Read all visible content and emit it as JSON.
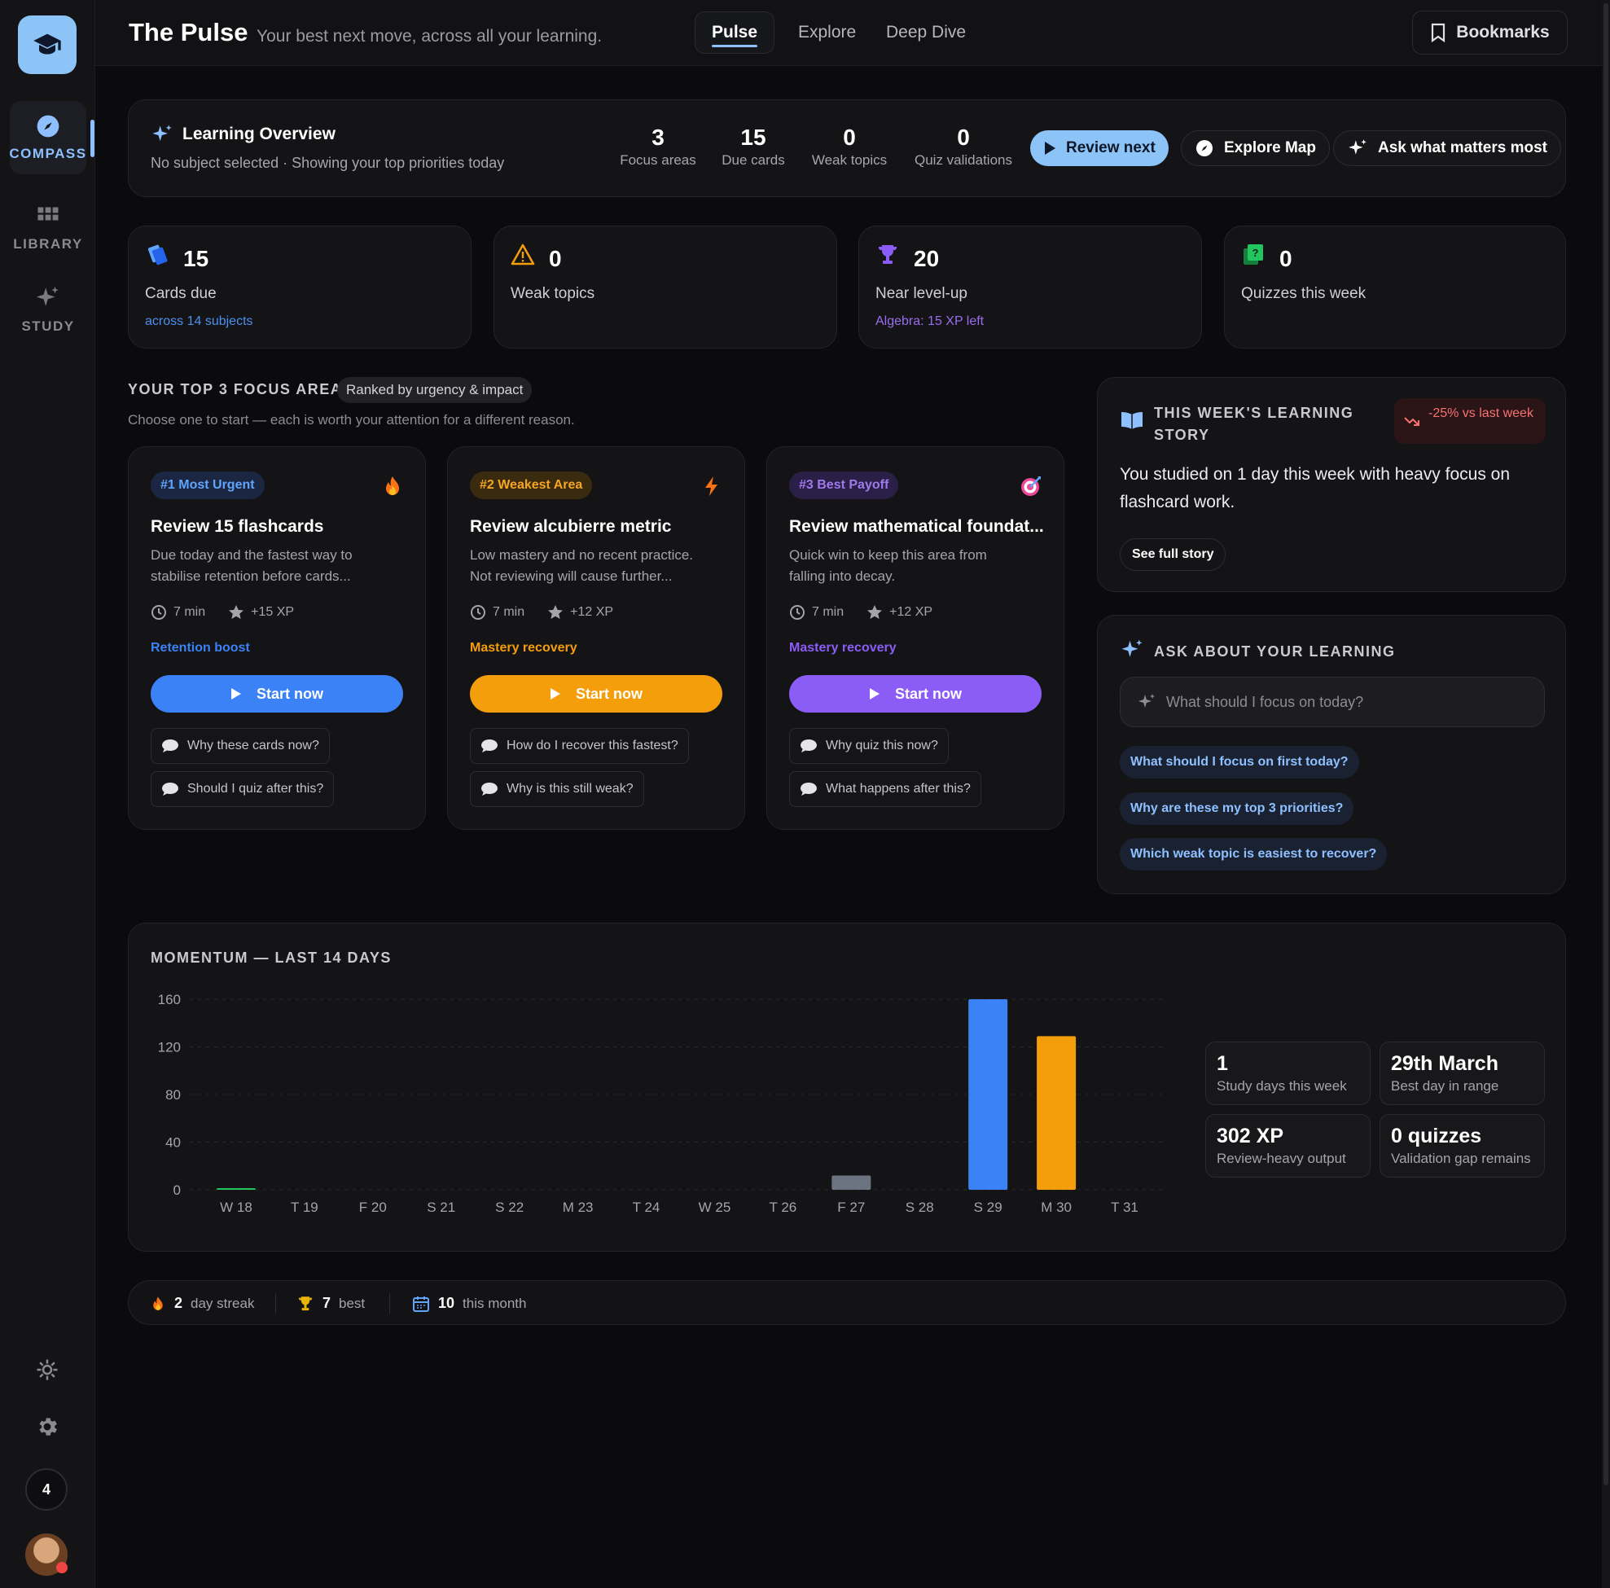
{
  "sidebar": {
    "nav": [
      {
        "label": "COMPASS",
        "icon": "compass-icon"
      },
      {
        "label": "LIBRARY",
        "icon": "grid-icon"
      },
      {
        "label": "STUDY",
        "icon": "sparkle-icon"
      }
    ],
    "notification_count": "4"
  },
  "header": {
    "title": "The Pulse",
    "subtitle": "Your best next move, across all your learning.",
    "tabs": [
      "Pulse",
      "Explore",
      "Deep Dive"
    ],
    "active_tab": "Pulse",
    "bookmarks_label": "Bookmarks"
  },
  "overview": {
    "title": "Learning Overview",
    "subtitle": "No subject selected · Showing your top priorities today",
    "stats": [
      {
        "value": "3",
        "label": "Focus areas"
      },
      {
        "value": "15",
        "label": "Due cards"
      },
      {
        "value": "0",
        "label": "Weak topics"
      },
      {
        "value": "0",
        "label": "Quiz validations"
      }
    ],
    "buttons": {
      "review_next": "Review next",
      "explore_map": "Explore Map",
      "ask": "Ask what matters most"
    }
  },
  "stat_cards": [
    {
      "value": "15",
      "label": "Cards due",
      "sub": "across 14 subjects",
      "sub_color": "#4d8ff0"
    },
    {
      "value": "0",
      "label": "Weak topics",
      "sub": ""
    },
    {
      "value": "20",
      "label": "Near level-up",
      "sub": "Algebra: 15 XP left",
      "sub_color": "#9a6cf0"
    },
    {
      "value": "0",
      "label": "Quizzes this week",
      "sub": ""
    }
  ],
  "focus": {
    "heading": "YOUR TOP 3 FOCUS AREAS",
    "ranked_badge": "Ranked by urgency & impact",
    "subheading": "Choose one to start — each is worth your attention for a different reason.",
    "cards": [
      {
        "badge": "#1 Most Urgent",
        "title": "Review 15 flashcards",
        "desc": "Due today and the fastest way to stabilise retention before cards...",
        "time": "7 min",
        "xp": "+15 XP",
        "tag": "Retention boost",
        "start": "Start now",
        "chips": [
          "Why these cards now?",
          "Should I quiz after this?"
        ],
        "accent": "#3b82f6",
        "emoji": "fire-icon"
      },
      {
        "badge": "#2 Weakest Area",
        "title": "Review alcubierre metric",
        "desc": "Low mastery and no recent practice. Not reviewing will cause further...",
        "time": "7 min",
        "xp": "+12 XP",
        "tag": "Mastery recovery",
        "start": "Start now",
        "chips": [
          "How do I recover this fastest?",
          "Why is this still weak?"
        ],
        "accent": "#f59e0b",
        "emoji": "lightning-icon"
      },
      {
        "badge": "#3 Best Payoff",
        "title": "Review mathematical foundat...",
        "desc": "Quick win to keep this area from falling into decay.",
        "time": "7 min",
        "xp": "+12 XP",
        "tag": "Mastery recovery",
        "start": "Start now",
        "chips": [
          "Why quiz this now?",
          "What happens after this?"
        ],
        "accent": "#8b5cf6",
        "emoji": "target-icon"
      }
    ]
  },
  "story": {
    "heading": "THIS WEEK'S LEARNING STORY",
    "trend": "-25% vs last week",
    "body": "You studied on 1 day this week with heavy focus on flashcard work.",
    "button": "See full story"
  },
  "ask": {
    "heading": "ASK ABOUT YOUR LEARNING",
    "placeholder": "What should I focus on today?",
    "suggestions": [
      "What should I focus on first today?",
      "Why are these my top 3 priorities?",
      "Which weak topic is easiest to recover?"
    ]
  },
  "momentum": {
    "heading": "MOMENTUM — LAST 14 DAYS",
    "stats": [
      {
        "value": "1",
        "label": "Study days this week"
      },
      {
        "value": "29th March",
        "label": "Best day in range"
      },
      {
        "value": "302 XP",
        "label": "Review-heavy output"
      },
      {
        "value": "0 quizzes",
        "label": "Validation gap remains"
      }
    ]
  },
  "chart_data": {
    "type": "bar",
    "title": "MOMENTUM — LAST 14 DAYS",
    "categories": [
      "W 18",
      "T 19",
      "F 20",
      "S 21",
      "S 22",
      "M 23",
      "T 24",
      "W 25",
      "T 26",
      "F 27",
      "S 28",
      "S 29",
      "M 30",
      "T 31"
    ],
    "values": [
      1,
      0,
      0,
      0,
      0,
      0,
      0,
      0,
      0,
      12,
      0,
      160,
      129,
      0
    ],
    "bar_colors": [
      "#22c55e",
      "#22c55e",
      "#22c55e",
      "#22c55e",
      "#22c55e",
      "#22c55e",
      "#22c55e",
      "#22c55e",
      "#22c55e",
      "#6b7280",
      "#22c55e",
      "#3b82f6",
      "#f59e0b",
      "#22c55e"
    ],
    "yticks": [
      0,
      40,
      80,
      120,
      160
    ],
    "ylim": [
      0,
      160
    ],
    "grid": true
  },
  "streak": {
    "items": [
      {
        "value": "2",
        "label": "day streak"
      },
      {
        "value": "7",
        "label": "best"
      },
      {
        "value": "10",
        "label": "this month"
      }
    ]
  }
}
